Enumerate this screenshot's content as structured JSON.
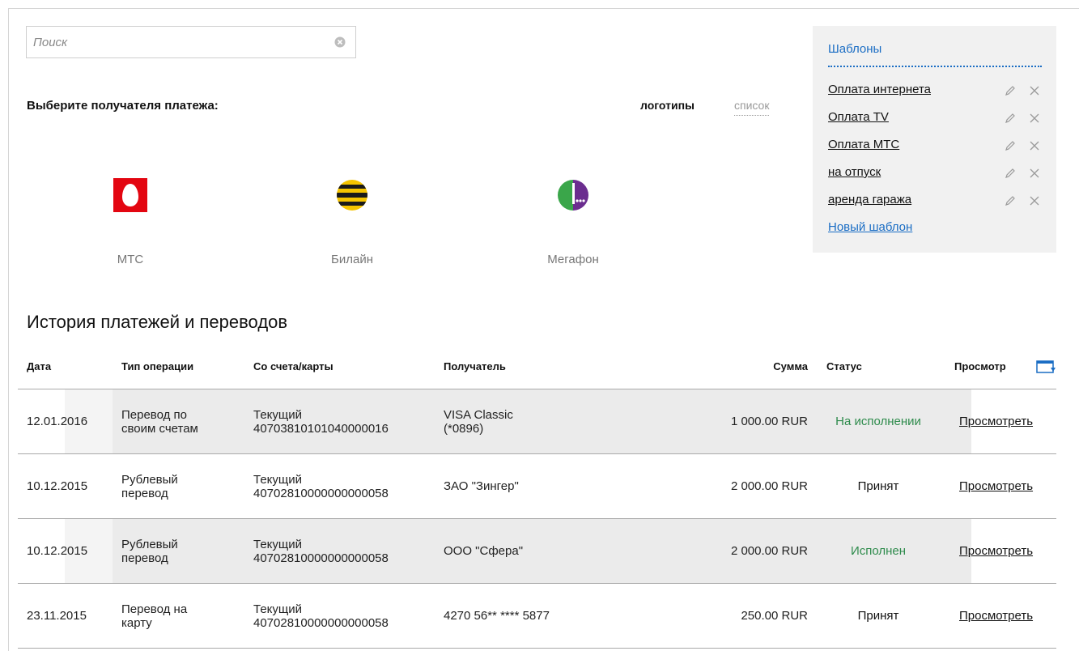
{
  "search": {
    "placeholder": "Поиск",
    "value": ""
  },
  "recipients": {
    "prompt": "Выберите получателя платежа:",
    "view_logos": "логотипы",
    "view_list": "список",
    "providers": [
      {
        "name": "МТС",
        "color": "#e30611"
      },
      {
        "name": "Билайн",
        "color": "#f5c400"
      },
      {
        "name": "Мегафон",
        "color": "#2f9e44"
      }
    ]
  },
  "templates": {
    "title": "Шаблоны",
    "items": [
      {
        "label": "Оплата интернета"
      },
      {
        "label": "Оплата TV"
      },
      {
        "label": "Оплата МТС"
      },
      {
        "label": "на отпуск"
      },
      {
        "label": "аренда гаража"
      }
    ],
    "new_label": "Новый шаблон"
  },
  "history": {
    "title": "История платежей и переводов",
    "columns": {
      "date": "Дата",
      "type": "Тип операции",
      "from": "Со счета/карты",
      "to": "Получатель",
      "sum": "Сумма",
      "status": "Статус",
      "view": "Просмотр"
    },
    "rows": [
      {
        "date": "12.01.2016",
        "type1": "Перевод по",
        "type2": "своим счетам",
        "from1": "Текущий",
        "from2": "40703810101040000016",
        "to1": "VISA Classic",
        "to2": "(*0896)",
        "sum": "1 000.00 RUR",
        "status": "На исполнении",
        "view": "Просмотреть"
      },
      {
        "date": "10.12.2015",
        "type1": "Рублевый",
        "type2": "перевод",
        "from1": "Текущий",
        "from2": "40702810000000000058",
        "to1": "ЗАО \"Зингер\"",
        "to2": "",
        "sum": "2 000.00 RUR",
        "status": "Принят",
        "view": "Просмотреть"
      },
      {
        "date": "10.12.2015",
        "type1": "Рублевый",
        "type2": "перевод",
        "from1": "Текущий",
        "from2": "40702810000000000058",
        "to1": "ООО \"Сфера\"",
        "to2": "",
        "sum": "2 000.00 RUR",
        "status": "Исполнен",
        "view": "Просмотреть"
      },
      {
        "date": "23.11.2015",
        "type1": "Перевод на",
        "type2": "карту",
        "from1": "Текущий",
        "from2": "40702810000000000058",
        "to1": "4270 56** **** 5877",
        "to2": "",
        "sum": "250.00 RUR",
        "status": "Принят",
        "view": "Просмотреть"
      }
    ]
  },
  "colors": {
    "link": "#1a6dc4",
    "status_green": "#2e8b4c",
    "row_shade": "#ebebeb"
  }
}
